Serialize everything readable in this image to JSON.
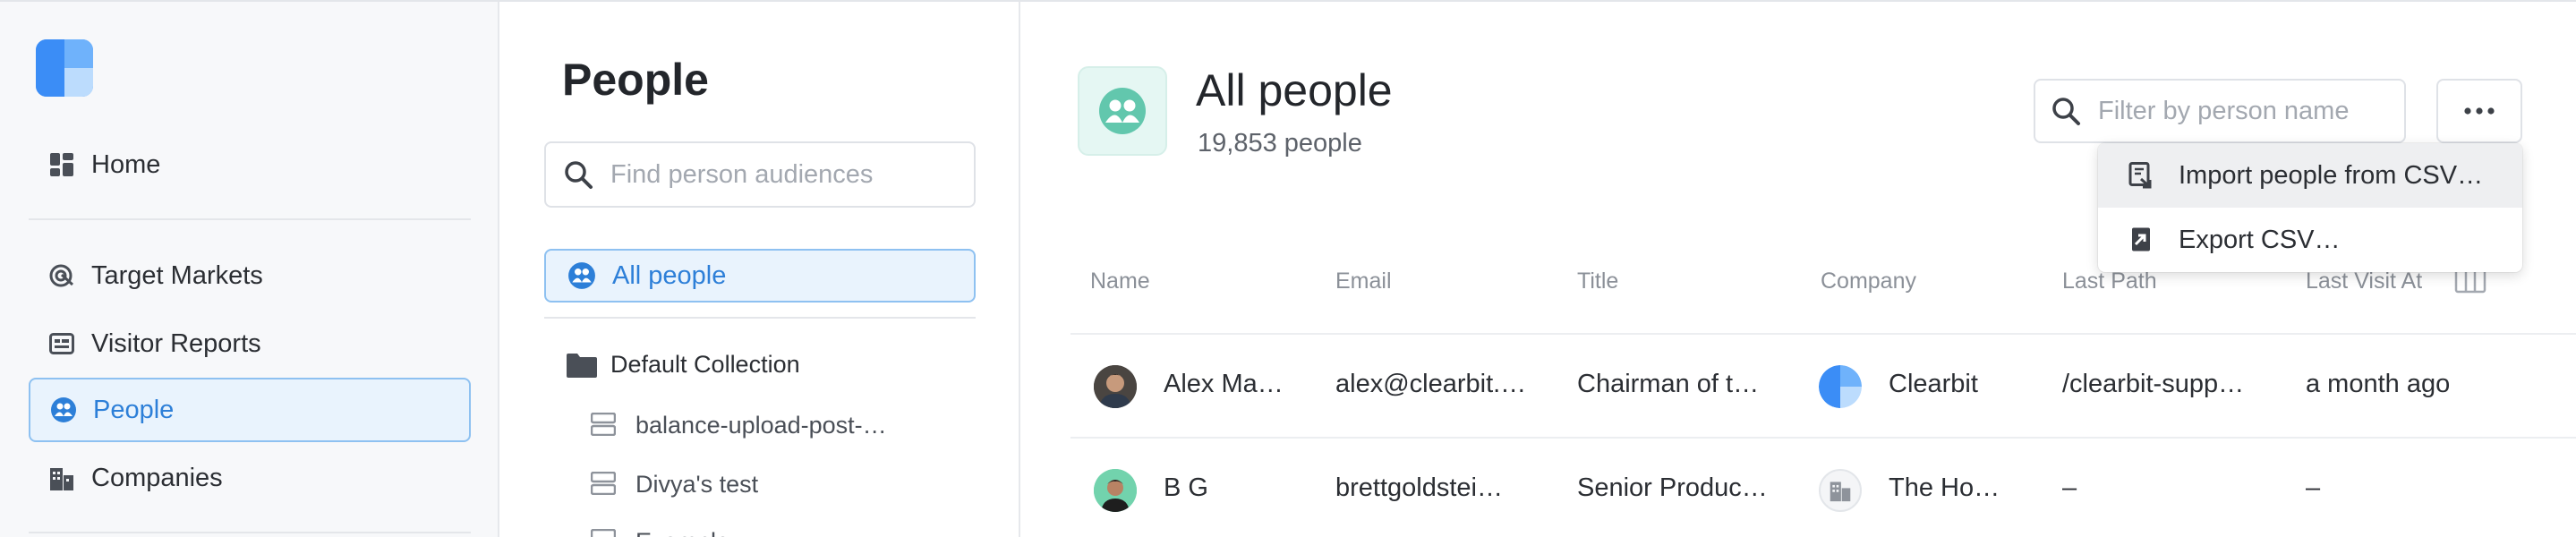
{
  "sidebar": {
    "nav": [
      {
        "label": "Home",
        "icon": "dashboard-icon"
      },
      {
        "label": "Target Markets",
        "icon": "target-icon"
      },
      {
        "label": "Visitor Reports",
        "icon": "report-icon"
      },
      {
        "label": "People",
        "icon": "people-icon"
      },
      {
        "label": "Companies",
        "icon": "buildings-icon"
      }
    ]
  },
  "audiences": {
    "title": "People",
    "search_placeholder": "Find person audiences",
    "active": "All people",
    "collection": "Default Collection",
    "items": [
      "balance-upload-post-…",
      "Divya's test",
      "Example …"
    ]
  },
  "main": {
    "title": "All people",
    "count": "19,853 people",
    "filter_placeholder": "Filter by person name",
    "menu": [
      "Import people from CSV…",
      "Export CSV…"
    ],
    "columns": [
      "Name",
      "Email",
      "Title",
      "Company",
      "Last Path",
      "Last Visit At"
    ],
    "rows": [
      {
        "name": "Alex Ma…",
        "email": "alex@clearbit.…",
        "title": "Chairman of t…",
        "company": "Clearbit",
        "last_path": "/clearbit-supp…",
        "last_visit": "a month ago"
      },
      {
        "name": "B G",
        "email": "brettgoldstei…",
        "title": "Senior Produc…",
        "company": "The Ho…",
        "last_path": "–",
        "last_visit": "–"
      }
    ]
  },
  "colors": {
    "accent": "#2d7fd8",
    "teal": "#62c7ad"
  }
}
